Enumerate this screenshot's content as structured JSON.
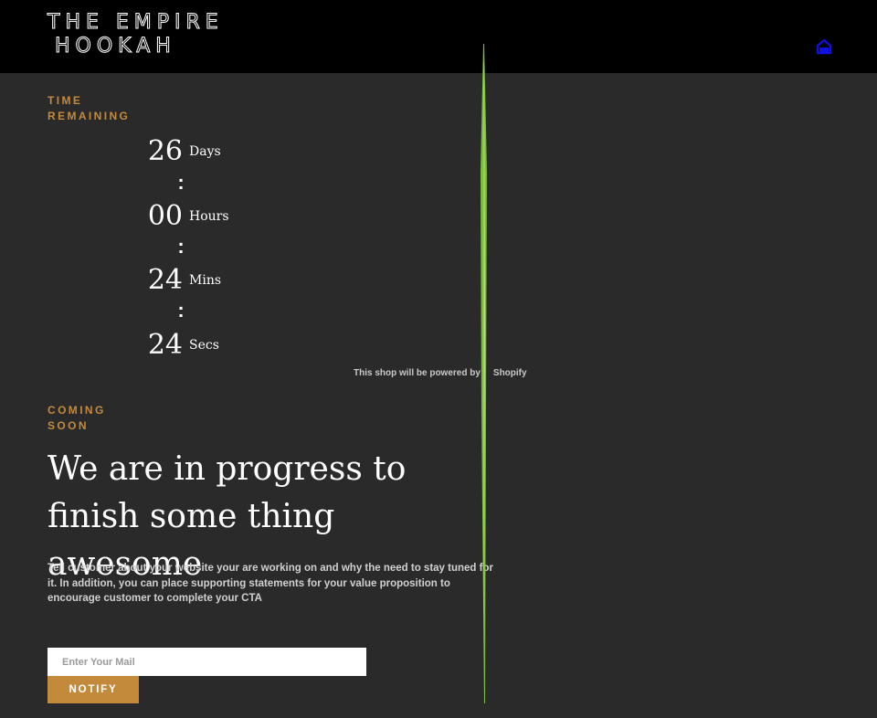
{
  "header": {
    "logo_line1": "THE EMPIRE",
    "logo_line2": "HOOKAH",
    "home_icon": "home-icon",
    "home_icon_color": "#1010e0"
  },
  "countdown": {
    "label_line1": "TIME",
    "label_line2": "REMAINING",
    "days": {
      "value": "26",
      "unit": "Days"
    },
    "hours": {
      "value": "00",
      "unit": "Hours"
    },
    "mins": {
      "value": "24",
      "unit": "Mins"
    },
    "secs": {
      "value": "24",
      "unit": "Secs"
    },
    "separator": ":"
  },
  "powered_by": {
    "text": "This shop will be powered by",
    "brand": "Shopify"
  },
  "main": {
    "eyebrow_line1": "COMING",
    "eyebrow_line2": "SOON",
    "headline": "We are in progress to finish some thing awesome",
    "description": "Tell customer about your website your are working on and why the need to stay tuned for it. In addition, you can place supporting statements for your value proposition to encourage customer to complete your CTA"
  },
  "signup": {
    "email_placeholder": "Enter Your Mail",
    "email_value": "",
    "button_label": "NOTIFY"
  },
  "colors": {
    "header_bg": "#000000",
    "page_bg": "#2a2a2a",
    "accent": "#c48a3c",
    "blade_green": "#7cbf3a"
  }
}
